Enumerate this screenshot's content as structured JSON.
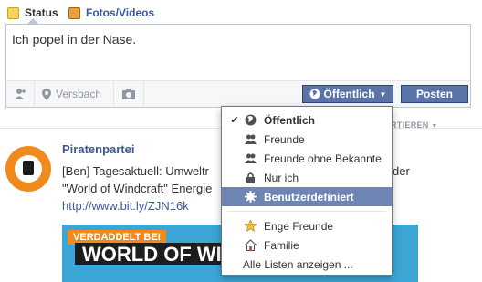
{
  "tabs": [
    {
      "label": "Status",
      "icon": "status-icon"
    },
    {
      "label": "Fotos/Videos",
      "icon": "photo-icon"
    }
  ],
  "composer": {
    "text": "Ich popel in der Nase.",
    "location": "Versbach",
    "privacy_label": "Öffentlich",
    "post_label": "Posten"
  },
  "feed": {
    "sort_label": "RTIEREN",
    "page_name": "Piratenpartei",
    "post_line1": "[Ben] Tagesaktuell: Umweltr",
    "post_line1_end": "der",
    "post_line2": "\"World of Windcraft\" Energie",
    "post_link": "http://www.bit.ly/ZJN16k",
    "image_banner_top": "VERDADDELT BEI",
    "image_banner_main": "WORLD OF WINDCRAFT"
  },
  "privacy_menu": {
    "items": [
      {
        "label": "Öffentlich",
        "icon": "globe-icon",
        "checked": true
      },
      {
        "label": "Freunde",
        "icon": "friends-icon"
      },
      {
        "label": "Freunde ohne Bekannte",
        "icon": "friends-icon"
      },
      {
        "label": "Nur ich",
        "icon": "lock-icon"
      },
      {
        "label": "Benutzerdefiniert",
        "icon": "gear-icon",
        "highlighted": true
      },
      {
        "label": "Enge Freunde",
        "icon": "star-icon"
      },
      {
        "label": "Familie",
        "icon": "house-icon"
      },
      {
        "label": "Alle Listen anzeigen ..."
      }
    ]
  },
  "colors": {
    "brand": "#3b5998",
    "button": "#5b74a8",
    "highlight": "#6d84b4"
  }
}
